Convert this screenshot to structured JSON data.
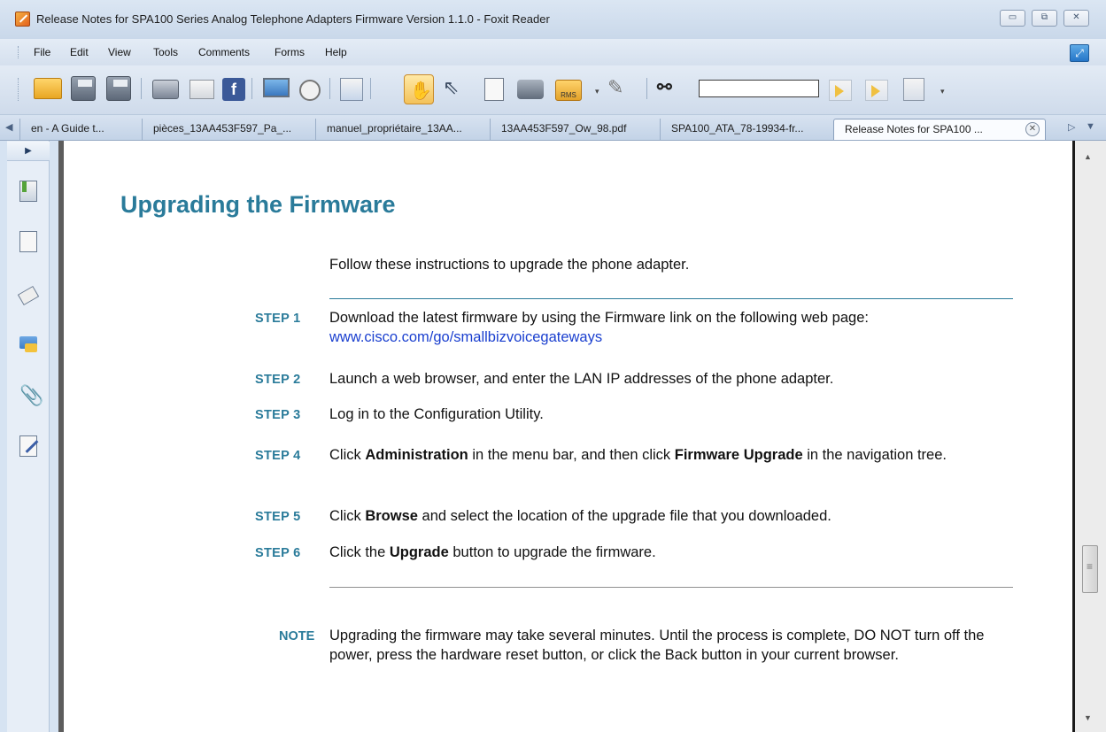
{
  "window": {
    "title": "Release Notes for SPA100 Series Analog Telephone Adapters Firmware Version 1.1.0 - Foxit Reader",
    "minimize": "▭",
    "restore": "⧉",
    "close": "✕"
  },
  "menu": [
    "File",
    "Edit",
    "View",
    "Tools",
    "Comments",
    "Forms",
    "Help"
  ],
  "toolbar": {
    "search_value": "",
    "icons": [
      "open-folder-icon",
      "save-icon",
      "save-as-icon",
      "print-icon",
      "card-icon",
      "facebook-icon",
      "screen-icon",
      "find-icon",
      "pages-icon",
      "hand-tool-icon",
      "select-arrow-icon",
      "text-select-icon",
      "snapshot-icon",
      "rms-lock-icon",
      "pen-icon",
      "binoculars-icon",
      "previous-view-icon",
      "next-view-icon",
      "hourglass-icon"
    ],
    "rms_label": "RMS"
  },
  "tabs": [
    {
      "label": "en - A Guide t..."
    },
    {
      "label": "pièces_13AA453F597_Pa_..."
    },
    {
      "label": "manuel_propriétaire_13AA..."
    },
    {
      "label": "13AA453F597_Ow_98.pdf"
    },
    {
      "label": "SPA100_ATA_78-19934-fr..."
    },
    {
      "label": "Release Notes for SPA100 ..."
    }
  ],
  "document": {
    "heading": "Upgrading the Firmware",
    "intro": "Follow these instructions to upgrade the phone adapter.",
    "steps": [
      {
        "label": "STEP  1",
        "parts": [
          "Download the latest firmware by using the Firmware link on the following web page: ",
          "www.cisco.com/go/smallbizvoicegateways"
        ]
      },
      {
        "label": "STEP  2",
        "parts": [
          "Launch a web browser, and enter the LAN IP addresses of the phone adapter."
        ]
      },
      {
        "label": "STEP  3",
        "parts": [
          "Log in to the Configuration Utility."
        ]
      },
      {
        "label": "STEP  4",
        "parts": [
          "Click ",
          "Administration",
          " in the menu bar, and then click ",
          "Firmware Upgrade",
          " in the navigation tree."
        ]
      },
      {
        "label": "STEP  5",
        "parts": [
          "Click ",
          "Browse",
          " and select the location of the upgrade file that you downloaded."
        ]
      },
      {
        "label": "STEP  6",
        "parts": [
          "Click the ",
          "Upgrade",
          " button to upgrade the firmware."
        ]
      }
    ],
    "note_label": "NOTE",
    "note_text": "Upgrading the firmware may take several minutes. Until the process is complete, DO NOT turn off the power, press the hardware reset button, or click the Back button in your current browser."
  }
}
